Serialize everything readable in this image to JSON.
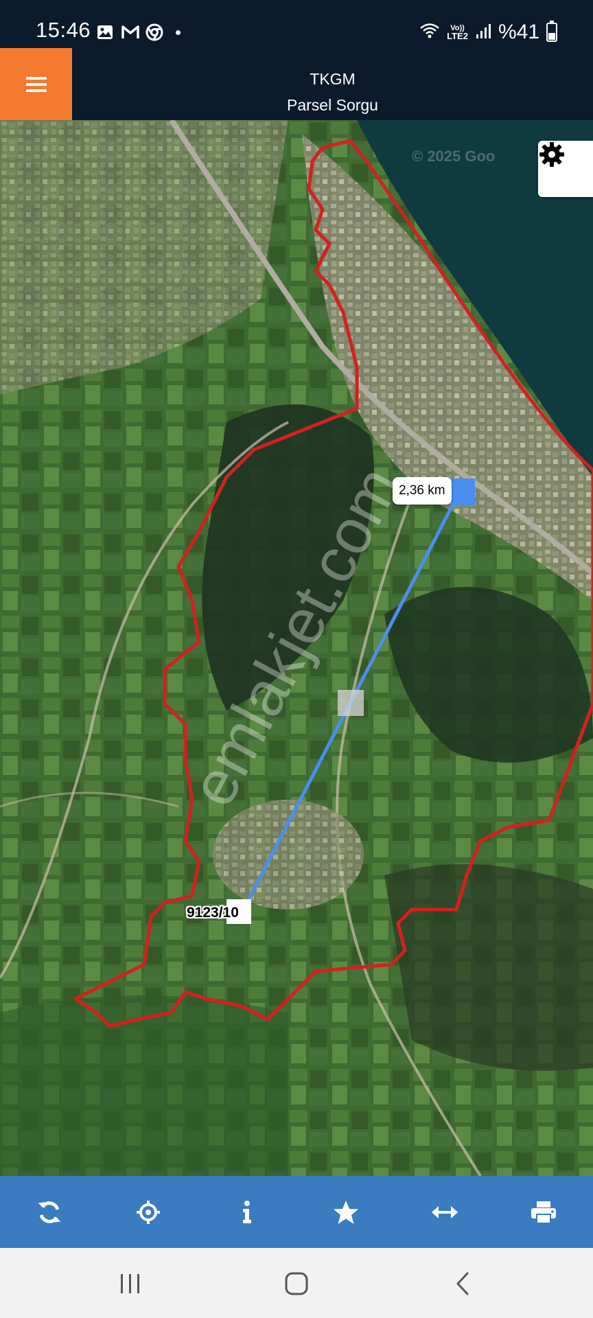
{
  "status_bar": {
    "time": "15:46",
    "battery": "%41",
    "network": "LTE2",
    "volte": "Vo))",
    "icons": [
      "gallery-icon",
      "gmail-icon",
      "chrome-icon",
      "notification-dot",
      "wifi-icon",
      "signal-icon",
      "battery-icon"
    ]
  },
  "header": {
    "title_line1": "TKGM",
    "title_line2": "Parsel Sorgu",
    "menu_icon": "hamburger-menu-icon",
    "accent_color": "#f47a30",
    "background_color": "#0b1a2c"
  },
  "map": {
    "distance_label": "2,36 km",
    "parcel_label": "9123/10",
    "watermark": "emlakjet.com",
    "attribution": "© 2025 Goo",
    "settings_icon": "gear-icon",
    "boundary_color": "#d42020",
    "measure_line_color": "#4a8ff0"
  },
  "toolbar": {
    "background_color": "#3b7bbf",
    "items": [
      {
        "icon": "refresh-icon"
      },
      {
        "icon": "locate-icon"
      },
      {
        "icon": "info-icon"
      },
      {
        "icon": "star-icon"
      },
      {
        "icon": "measure-icon"
      },
      {
        "icon": "print-icon"
      }
    ]
  },
  "navbar": {
    "items": [
      {
        "icon": "recent-apps-icon"
      },
      {
        "icon": "home-icon"
      },
      {
        "icon": "back-icon"
      }
    ]
  }
}
